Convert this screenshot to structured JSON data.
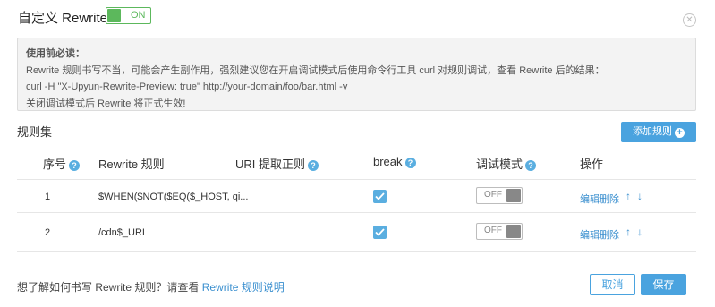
{
  "header": {
    "title": "自定义 Rewrite",
    "toggle_label": "ON"
  },
  "close_glyph": "✕",
  "notice": {
    "title": "使用前必读",
    "line1": "Rewrite 规则书写不当，可能会产生副作用，强烈建议您在开启调试模式后使用命令行工具 curl 对规则调试，查看 Rewrite 后的结果：",
    "line2": "curl -H \"X-Upyun-Rewrite-Preview: true\" http://your-domain/foo/bar.html -v",
    "line3": "关闭调试模式后 Rewrite 将正式生效!"
  },
  "ruleset": {
    "title": "规则集",
    "add_button": "添加规则",
    "add_icon": "+"
  },
  "table": {
    "headers": {
      "index": "序号",
      "rule": "Rewrite 规则",
      "uri": "URI 提取正则",
      "break": "break",
      "debug": "调试模式",
      "actions": "操作"
    },
    "help_glyph": "?",
    "rows": [
      {
        "index": "1",
        "rule": "$WHEN($NOT($EQ($_HOST, qi...",
        "uri": "",
        "break": true,
        "debug": "OFF",
        "edit": "编辑",
        "delete": "删除"
      },
      {
        "index": "2",
        "rule": "/cdn$_URI",
        "uri": "",
        "break": true,
        "debug": "OFF",
        "edit": "编辑",
        "delete": "删除"
      }
    ],
    "up_glyph": "↑",
    "down_glyph": "↓"
  },
  "footer": {
    "question": "想了解如何书写 Rewrite 规则？请查看",
    "link": "Rewrite 规则说明",
    "cancel": "取消",
    "save": "保存"
  },
  "colors": {
    "accent": "#4aa3df",
    "toggle_on": "#5cb85c",
    "link": "#3a8fcf"
  }
}
